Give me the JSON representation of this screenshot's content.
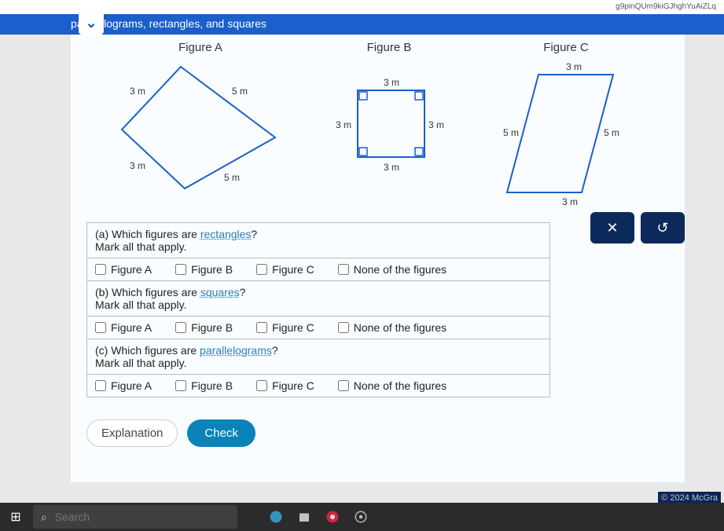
{
  "browser": {
    "url_fragment": "g9pinQUm9kiGJhghYuAiZLq"
  },
  "header": {
    "topic": "parallelograms, rectangles, and squares"
  },
  "figures": {
    "a": {
      "title": "Figure A",
      "sides": [
        "3 m",
        "5 m",
        "3 m",
        "5 m"
      ]
    },
    "b": {
      "title": "Figure B",
      "sides": [
        "3 m",
        "3 m",
        "3 m",
        "3 m"
      ]
    },
    "c": {
      "title": "Figure C",
      "sides": [
        "3 m",
        "5 m",
        "5 m",
        "3 m"
      ]
    }
  },
  "questions": {
    "a": {
      "prompt_prefix": "(a) Which figures are ",
      "term": "rectangles",
      "prompt_suffix": "?",
      "instruction": "Mark all that apply."
    },
    "b": {
      "prompt_prefix": "(b) Which figures are ",
      "term": "squares",
      "prompt_suffix": "?",
      "instruction": "Mark all that apply."
    },
    "c": {
      "prompt_prefix": "(c) Which figures are ",
      "term": "parallelograms",
      "prompt_suffix": "?",
      "instruction": "Mark all that apply."
    }
  },
  "options": {
    "figA": "Figure A",
    "figB": "Figure B",
    "figC": "Figure C",
    "none": "None of the figures"
  },
  "buttons": {
    "explanation": "Explanation",
    "check": "Check",
    "close": "✕",
    "reset": "↺"
  },
  "taskbar": {
    "search_placeholder": "Search"
  },
  "copyright": "© 2024 McGra"
}
